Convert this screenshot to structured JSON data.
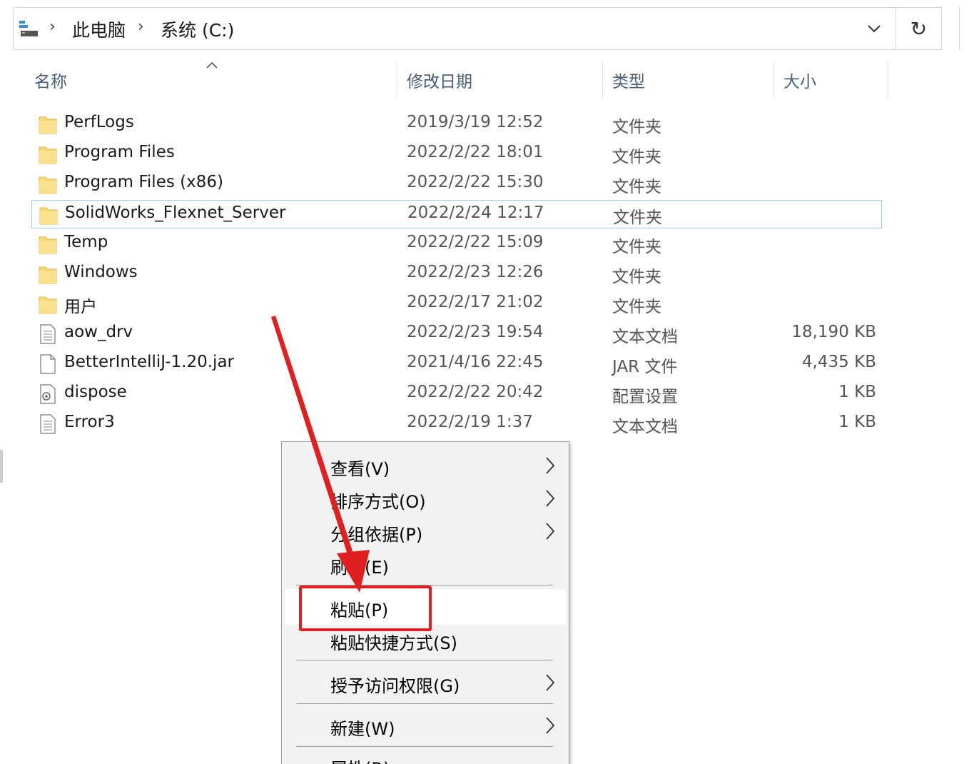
{
  "breadcrumb": {
    "items": [
      "此电脑",
      "系统 (C:)"
    ],
    "separator": "›"
  },
  "toolbar": {
    "refresh_glyph": "↻"
  },
  "columns": {
    "name": "名称",
    "date": "修改日期",
    "type": "类型",
    "size": "大小"
  },
  "files": [
    {
      "name": "PerfLogs",
      "date": "2019/3/19 12:52",
      "type": "文件夹",
      "size": "",
      "icon": "folder-icon"
    },
    {
      "name": "Program Files",
      "date": "2022/2/22 18:01",
      "type": "文件夹",
      "size": "",
      "icon": "folder-icon"
    },
    {
      "name": "Program Files (x86)",
      "date": "2022/2/22 15:30",
      "type": "文件夹",
      "size": "",
      "icon": "folder-icon"
    },
    {
      "name": "SolidWorks_Flexnet_Server",
      "date": "2022/2/24 12:17",
      "type": "文件夹",
      "size": "",
      "icon": "folder-icon"
    },
    {
      "name": "Temp",
      "date": "2022/2/22 15:09",
      "type": "文件夹",
      "size": "",
      "icon": "folder-icon"
    },
    {
      "name": "Windows",
      "date": "2022/2/23 12:26",
      "type": "文件夹",
      "size": "",
      "icon": "folder-icon"
    },
    {
      "name": "用户",
      "date": "2022/2/17 21:02",
      "type": "文件夹",
      "size": "",
      "icon": "folder-icon"
    },
    {
      "name": "aow_drv",
      "date": "2022/2/23 19:54",
      "type": "文本文档",
      "size": "18,190 KB",
      "icon": "text-document-icon"
    },
    {
      "name": "BetterIntelliJ-1.20.jar",
      "date": "2021/4/16 22:45",
      "type": "JAR 文件",
      "size": "4,435 KB",
      "icon": "blank-file-icon"
    },
    {
      "name": "dispose",
      "date": "2022/2/22 20:42",
      "type": "配置设置",
      "size": "1 KB",
      "icon": "config-file-icon"
    },
    {
      "name": "Error3",
      "date": "2022/2/19 1:37",
      "type": "文本文档",
      "size": "1 KB",
      "icon": "text-document-icon"
    }
  ],
  "context_menu": {
    "items": [
      {
        "label": "查看(V)",
        "submenu": true
      },
      {
        "label": "排序方式(O)",
        "submenu": true
      },
      {
        "label": "分组依据(P)",
        "submenu": true
      },
      {
        "label": "刷新(E)",
        "submenu": false
      },
      {
        "label": "粘贴(P)",
        "submenu": false
      },
      {
        "label": "粘贴快捷方式(S)",
        "submenu": false
      },
      {
        "label": "授予访问权限(G)",
        "submenu": true
      },
      {
        "label": "新建(W)",
        "submenu": true
      },
      {
        "label": "属性(R)",
        "submenu": false
      }
    ]
  },
  "colors": {
    "selection_border": "#99d1ff",
    "annotation_red": "#e02020",
    "folder_yellow": "#f8d775"
  }
}
